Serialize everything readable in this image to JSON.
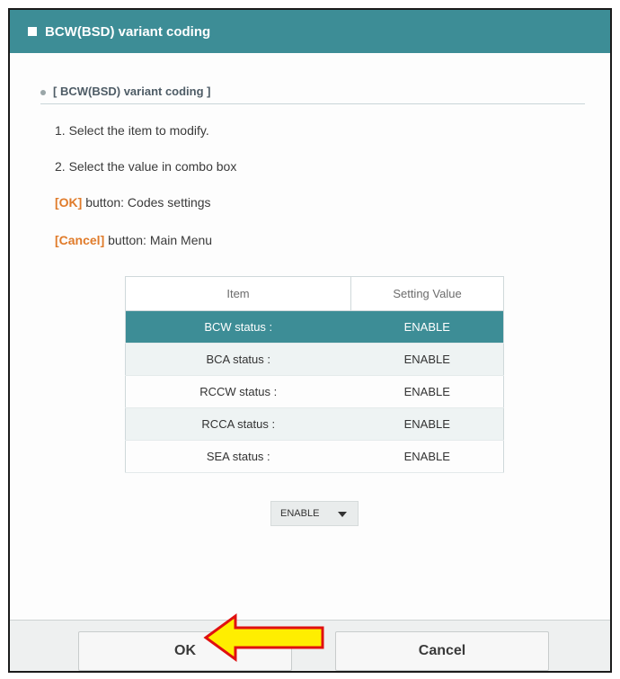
{
  "dialog": {
    "title": "BCW(BSD) variant coding",
    "section_title": "[ BCW(BSD) variant coding ]",
    "accent_color": "#3d8d96",
    "highlight_color": "#e07b2a"
  },
  "instructions": {
    "line1": "1. Select the item to modify.",
    "line2": "2. Select the value in combo box",
    "ok_tag": "[OK]",
    "ok_text": " button: Codes settings",
    "cancel_tag": "[Cancel]",
    "cancel_text": " button: Main Menu"
  },
  "table": {
    "headers": [
      "Item",
      "Setting Value"
    ],
    "rows": [
      {
        "item": "BCW status :",
        "value": "ENABLE",
        "selected": true
      },
      {
        "item": "BCA status :",
        "value": "ENABLE",
        "selected": false
      },
      {
        "item": "RCCW status :",
        "value": "ENABLE",
        "selected": false
      },
      {
        "item": "RCCA status :",
        "value": "ENABLE",
        "selected": false
      },
      {
        "item": "SEA status :",
        "value": "ENABLE",
        "selected": false
      }
    ]
  },
  "combo": {
    "selected": "ENABLE",
    "icon": "chevron-down-icon"
  },
  "buttons": {
    "ok_label": "OK",
    "cancel_label": "Cancel"
  },
  "annotation": {
    "icon": "arrow-left-icon",
    "fill": "#ffee00",
    "stroke": "#e01010"
  }
}
